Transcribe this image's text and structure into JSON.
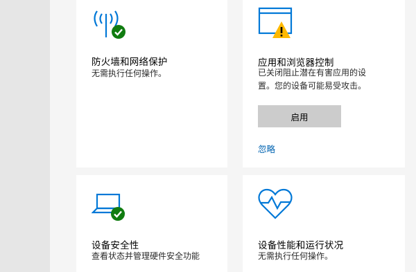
{
  "tiles": {
    "firewall": {
      "title": "防火墙和网络保护",
      "desc": "无需执行任何操作。",
      "icon": "wifi-antenna-icon",
      "status_icon": "check-circle-icon"
    },
    "app_browser": {
      "title": "应用和浏览器控制",
      "desc_line1": "已关闭阻止潜在有害应用的设",
      "desc_line2": "置。您的设备可能易受攻击。",
      "icon": "browser-window-icon",
      "status_icon": "warning-triangle-icon",
      "button_label": "启用",
      "link_label": "忽略"
    },
    "device_security": {
      "title": "设备安全性",
      "desc": "查看状态并管理硬件安全功能",
      "icon": "laptop-icon",
      "status_icon": "check-circle-icon"
    },
    "device_health": {
      "title": "设备性能和运行状况",
      "desc": "无需执行任何操作。",
      "icon": "heart-pulse-icon"
    }
  },
  "colors": {
    "accent_blue": "#0078d7",
    "link_blue": "#0063b1",
    "ok_green": "#107c10",
    "warning_yellow": "#ffb900",
    "button_gray": "#cccccc",
    "rail_gray": "#e6e6e6"
  }
}
